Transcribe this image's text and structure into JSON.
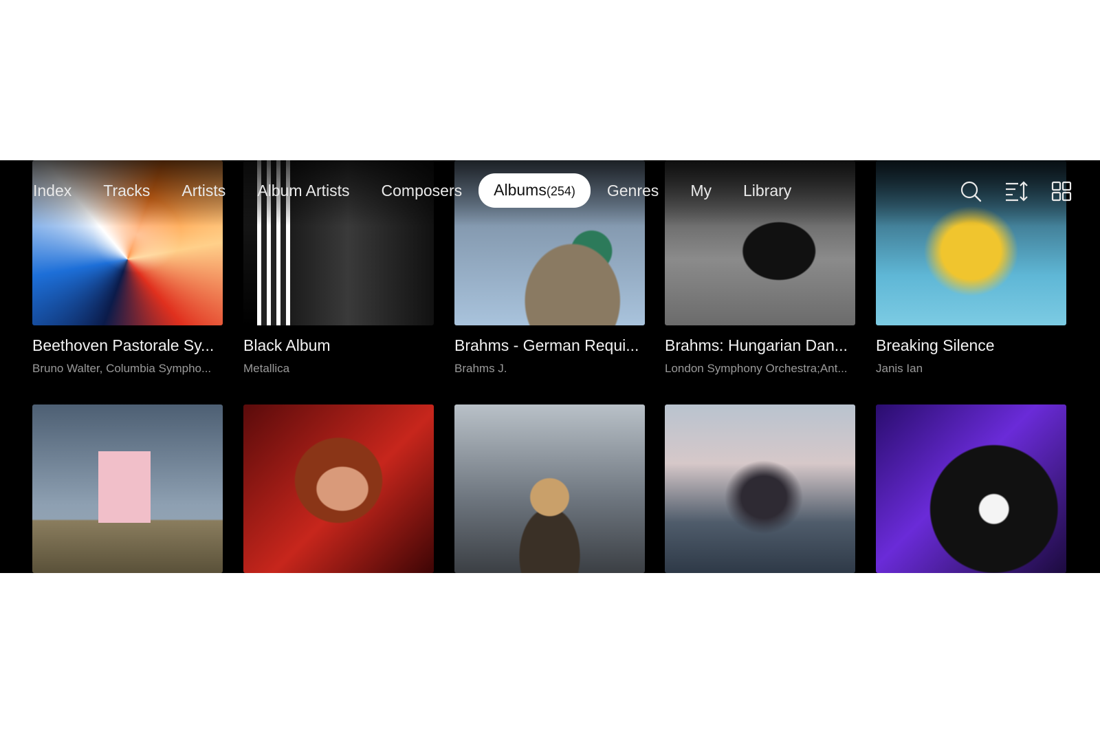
{
  "nav": {
    "tabs": [
      {
        "label": "Index"
      },
      {
        "label": "Tracks"
      },
      {
        "label": "Artists"
      },
      {
        "label": "Album Artists"
      },
      {
        "label": "Composers"
      },
      {
        "label": "Albums",
        "count": "(254)",
        "active": true
      },
      {
        "label": "Genres"
      },
      {
        "label": "My"
      },
      {
        "label": "Library"
      }
    ],
    "icons": [
      "search-icon",
      "sort-icon",
      "grid-view-icon"
    ]
  },
  "albums": [
    {
      "title": "Beethoven Pastorale Sy...",
      "artist": "Bruno Walter, Columbia Sympho..."
    },
    {
      "title": "Black Album",
      "artist": "Metallica"
    },
    {
      "title": "Brahms - German Requi...",
      "artist": "Brahms J."
    },
    {
      "title": "Brahms: Hungarian Dan...",
      "artist": "London Symphony Orchestra;Ant..."
    },
    {
      "title": "Breaking Silence",
      "artist": "Janis Ian"
    },
    {
      "title": "",
      "artist": ""
    },
    {
      "title": "",
      "artist": ""
    },
    {
      "title": "",
      "artist": ""
    },
    {
      "title": "",
      "artist": ""
    },
    {
      "title": "",
      "artist": ""
    }
  ]
}
